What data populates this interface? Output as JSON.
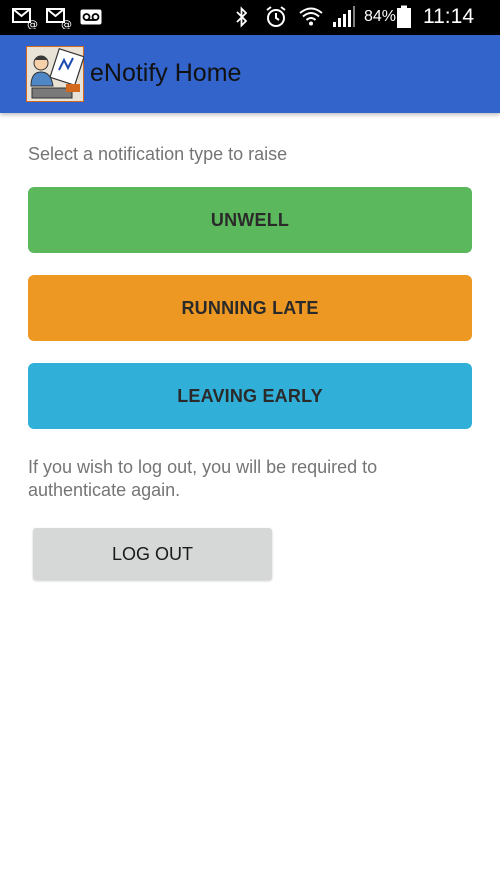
{
  "status_bar": {
    "battery": "84%",
    "time": "11:14",
    "icons": [
      "missed-email-icon",
      "missed-email-icon",
      "voicemail-icon",
      "bluetooth-icon",
      "alarm-icon",
      "wifi-icon",
      "signal-icon",
      "battery-icon"
    ]
  },
  "app_bar": {
    "title": "eNotify Home",
    "logo": "enotify-logo"
  },
  "main": {
    "prompt": "Select a notification type to raise",
    "buttons": {
      "unwell": "UNWELL",
      "running_late": "RUNNING LATE",
      "leaving_early": "LEAVING EARLY"
    },
    "logout_message": "If you wish to log out, you will be required to authenticate again.",
    "logout_label": "LOG OUT"
  },
  "colors": {
    "app_bar": "#3264cc",
    "unwell": "#5cb85c",
    "running_late": "#ec9822",
    "leaving_early": "#30b0d8",
    "logout": "#d6d7d7"
  }
}
